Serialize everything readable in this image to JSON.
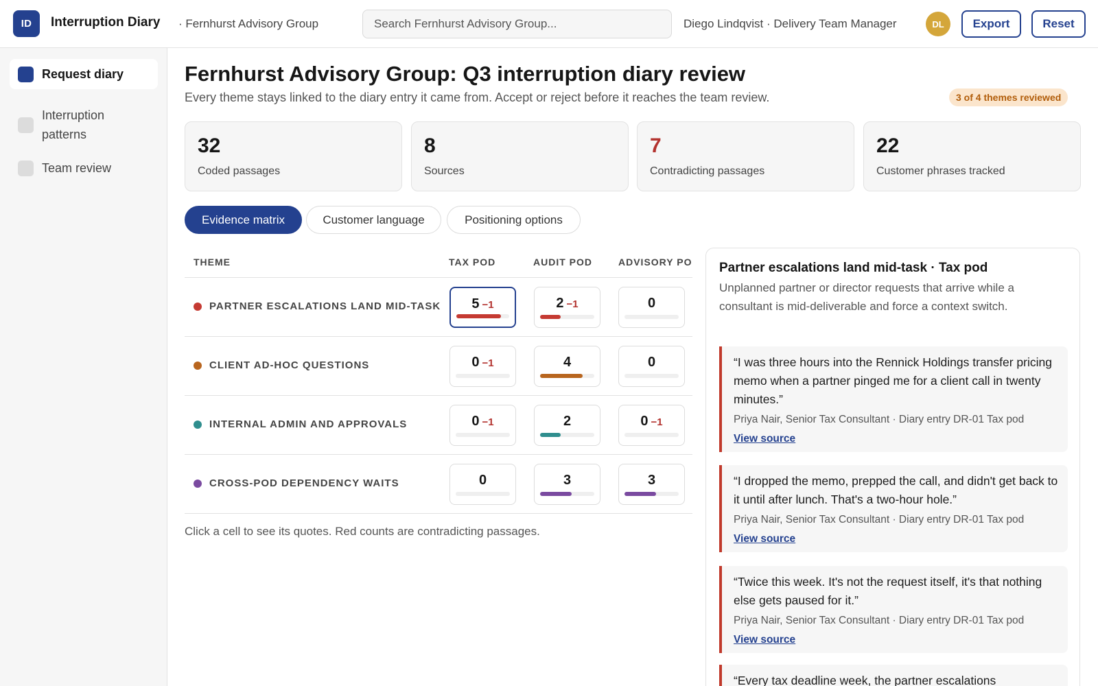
{
  "app": {
    "logo_text": "ID",
    "title": "Interruption Diary",
    "org": "· Fernhurst Advisory Group",
    "search_placeholder": "Search Fernhurst Advisory Group...",
    "user_label": "Diego Lindqvist · Delivery Team Manager",
    "avatar_initials": "DL",
    "export_label": "Export",
    "reset_label": "Reset"
  },
  "sidebar": {
    "items": [
      {
        "label": "Request diary",
        "active": true
      },
      {
        "label": "Interruption patterns",
        "active": false
      },
      {
        "label": "Team review",
        "active": false
      }
    ]
  },
  "page": {
    "title": "Fernhurst Advisory Group: Q3 interruption diary review",
    "subtitle": "Every theme stays linked to the diary entry it came from. Accept or reject before it reaches the team review.",
    "review_badge": "3 of 4 themes reviewed"
  },
  "stats": [
    {
      "value": "32",
      "label": "Coded passages"
    },
    {
      "value": "8",
      "label": "Sources"
    },
    {
      "value": "7",
      "label": "Contradicting passages",
      "alert": true
    },
    {
      "value": "22",
      "label": "Customer phrases tracked"
    }
  ],
  "tabs": [
    {
      "label": "Evidence matrix",
      "active": true
    },
    {
      "label": "Customer language",
      "active": false
    },
    {
      "label": "Positioning options",
      "active": false
    }
  ],
  "matrix": {
    "headers": {
      "theme": "THEME",
      "cols": [
        "TAX POD",
        "AUDIT POD",
        "ADVISORY POD"
      ]
    },
    "rows": [
      {
        "theme": "PARTNER ESCALATIONS LAND MID-TASK",
        "color": "#c53a32",
        "cells": [
          {
            "count": "5",
            "contra": "−1",
            "fill": 0.85,
            "selected": true
          },
          {
            "count": "2",
            "contra": "−1",
            "fill": 0.38
          },
          {
            "count": "0",
            "contra": "",
            "fill": 0
          }
        ]
      },
      {
        "theme": "CLIENT AD-HOC QUESTIONS",
        "color": "#b8651e",
        "cells": [
          {
            "count": "0",
            "contra": "−1",
            "fill": 0
          },
          {
            "count": "4",
            "contra": "",
            "fill": 0.78
          },
          {
            "count": "0",
            "contra": "",
            "fill": 0
          }
        ]
      },
      {
        "theme": "INTERNAL ADMIN AND APPROVALS",
        "color": "#2f8e8e",
        "cells": [
          {
            "count": "0",
            "contra": "−1",
            "fill": 0
          },
          {
            "count": "2",
            "contra": "",
            "fill": 0.38
          },
          {
            "count": "0",
            "contra": "−1",
            "fill": 0
          }
        ]
      },
      {
        "theme": "CROSS-POD DEPENDENCY WAITS",
        "color": "#7a4aa0",
        "cells": [
          {
            "count": "0",
            "contra": "",
            "fill": 0
          },
          {
            "count": "3",
            "contra": "",
            "fill": 0.58
          },
          {
            "count": "3",
            "contra": "",
            "fill": 0.58
          }
        ]
      }
    ],
    "note": "Click a cell to see its quotes. Red counts are contradicting passages."
  },
  "detail": {
    "title": "Partner escalations land mid-task · Tax pod",
    "description": "Unplanned partner or director requests that arrive while a consultant is mid-deliverable and force a context switch.",
    "quotes": [
      {
        "text": "“I was three hours into the Rennick Holdings transfer pricing memo when a partner pinged me for a client call in twenty minutes.”",
        "meta": "Priya Nair, Senior Tax Consultant · Diary entry DR-01  Tax pod",
        "link": "View source"
      },
      {
        "text": "“I dropped the memo, prepped the call, and didn't get back to it until after lunch. That's a two-hour hole.”",
        "meta": "Priya Nair, Senior Tax Consultant · Diary entry DR-01  Tax pod",
        "link": "View source"
      },
      {
        "text": "“Twice this week. It's not the request itself, it's that nothing else gets paused for it.”",
        "meta": "Priya Nair, Senior Tax Consultant · Diary entry DR-01  Tax pod",
        "link": "View source"
      },
      {
        "text": "“Every tax deadline week, the partner escalations",
        "meta": "",
        "link": ""
      }
    ]
  }
}
